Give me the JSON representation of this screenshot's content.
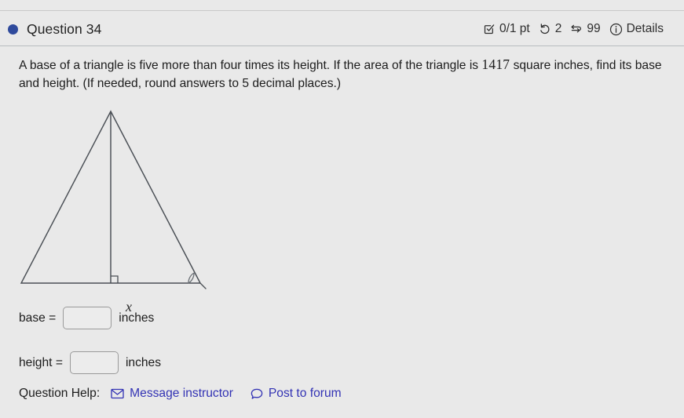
{
  "header": {
    "question_label": "Question 34",
    "dot_color": "#2f4a9c",
    "score": "0/1 pt",
    "attempts": "2",
    "version": "99",
    "details_label": "Details",
    "icons": {
      "score": "checkbox-check-icon",
      "attempts": "undo-arrow-icon",
      "version": "swap-arrows-icon",
      "details": "info-circle-icon"
    }
  },
  "statement": {
    "part1": "A base of a triangle is five more than four times its height. If the area of the triangle is ",
    "area_value": "1417",
    "part2": " square inches, find its base and height. (If needed, round answers to 5 decimal places.)"
  },
  "figure": {
    "altitude_label": "x",
    "stroke_color": "#4a4f55",
    "description": "triangle-with-altitude"
  },
  "answers": {
    "base": {
      "label": "base =",
      "value": "",
      "placeholder": "",
      "unit": "inches"
    },
    "height": {
      "label": "height =",
      "value": "",
      "placeholder": "",
      "unit": "inches"
    }
  },
  "help": {
    "label": "Question Help:",
    "message_instructor": "Message instructor",
    "post_to_forum": "Post to forum",
    "link_color": "#3232b4"
  }
}
